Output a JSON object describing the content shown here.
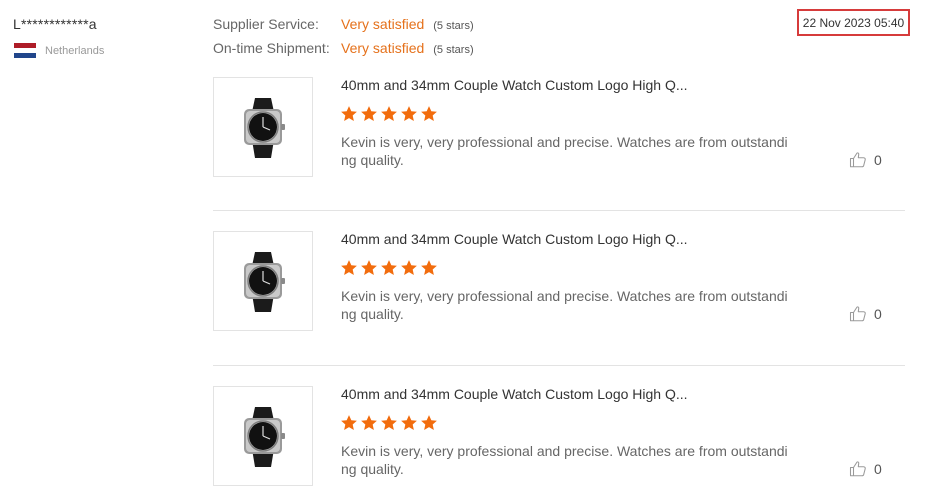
{
  "reviewer": {
    "name": "L************a",
    "country": "Netherlands",
    "flag_colors": [
      "#ae1c28",
      "#ffffff",
      "#21468b"
    ]
  },
  "ratings": [
    {
      "label": "Supplier Service:",
      "value": "Very satisfied",
      "stars": "(5 stars)"
    },
    {
      "label": "On-time Shipment:",
      "value": "Very satisfied",
      "stars": "(5 stars)"
    }
  ],
  "date": "22 Nov 2023 05:40",
  "colors": {
    "accent": "#e5711b",
    "star": "#f26c0d",
    "highlight_border": "#d63b3b"
  },
  "reviews": [
    {
      "product_title": "40mm and 34mm Couple Watch Custom Logo High Q...",
      "star_rating": 5,
      "text": "Kevin is very, very professional and precise. Watches are from outstanding quality.",
      "like_icon": "thumbs-up-icon",
      "likes": "0"
    },
    {
      "product_title": "40mm and 34mm Couple Watch Custom Logo High Q...",
      "star_rating": 5,
      "text": "Kevin is very, very professional and precise. Watches are from outstanding quality.",
      "like_icon": "thumbs-up-icon",
      "likes": "0"
    },
    {
      "product_title": "40mm and 34mm Couple Watch Custom Logo High Q...",
      "star_rating": 5,
      "text": "Kevin is very, very professional and precise. Watches are from outstanding quality.",
      "like_icon": "thumbs-up-icon",
      "likes": "0"
    }
  ]
}
